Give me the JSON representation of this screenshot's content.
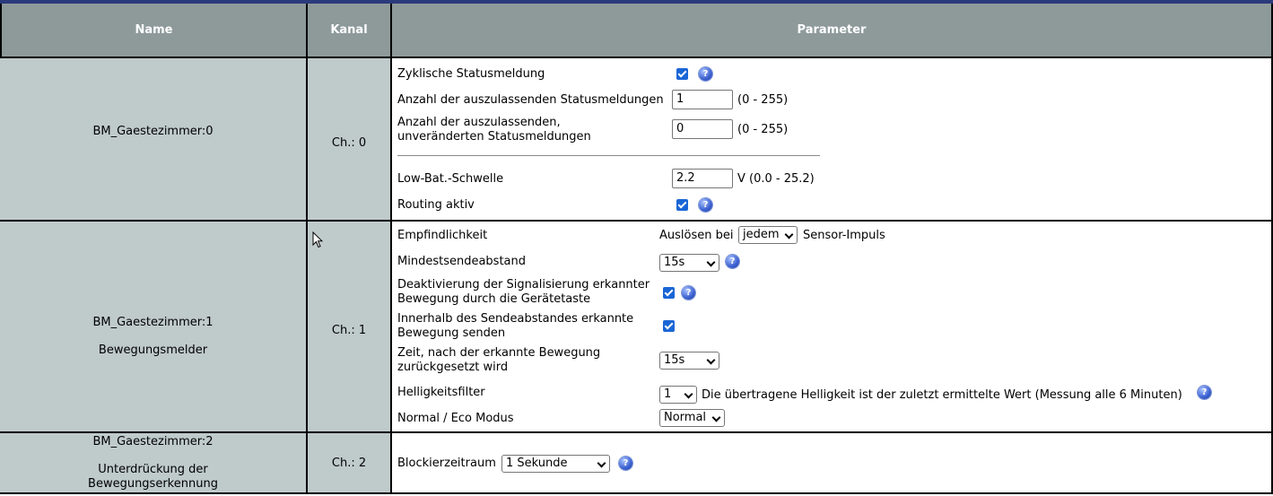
{
  "header": {
    "name": "Name",
    "kanal": "Kanal",
    "parameter": "Parameter"
  },
  "rows": [
    {
      "name": "BM_Gaestezimmer:0",
      "channel": "Ch.: 0",
      "params": {
        "cyclic_status_label": "Zyklische Statusmeldung",
        "cyclic_status_checked": true,
        "skip_status_label": "Anzahl der auszulassenden Statusmeldungen",
        "skip_status_value": "1",
        "skip_status_range": "(0 - 255)",
        "skip_unchanged_label": "Anzahl der auszulassenden, unveränderten Statusmeldungen",
        "skip_unchanged_value": "0",
        "skip_unchanged_range": "(0 - 255)",
        "lowbat_label": "Low-Bat.-Schwelle",
        "lowbat_value": "2.2",
        "lowbat_unit_range": "V (0.0 - 25.2)",
        "routing_label": "Routing aktiv",
        "routing_checked": true
      }
    },
    {
      "name": "BM_Gaestezimmer:1",
      "subname": "Bewegungsmelder",
      "channel": "Ch.: 1",
      "params": {
        "sensitivity_label": "Empfindlichkeit",
        "sensitivity_prefix": "Auslösen bei",
        "sensitivity_value": "jedem",
        "sensitivity_suffix": "Sensor-Impuls",
        "min_interval_label": "Mindestsendeabstand",
        "min_interval_value": "15s",
        "deactivate_signal_label": "Deaktivierung der Signalisierung erkannter Bewegung durch die Gerätetaste",
        "deactivate_signal_checked": true,
        "send_within_label": "Innerhalb des Sendeabstandes erkannte Bewegung senden",
        "send_within_checked": true,
        "reset_time_label": "Zeit, nach der erkannte Bewegung zurückgesetzt wird",
        "reset_time_value": "15s",
        "brightness_label": "Helligkeitsfilter",
        "brightness_value": "1",
        "brightness_note": "Die übertragene Helligkeit ist der zuletzt ermittelte Wert (Messung alle 6 Minuten)",
        "mode_label": "Normal / Eco Modus",
        "mode_value": "Normal"
      }
    },
    {
      "name": "BM_Gaestezimmer:2",
      "subname": "Unterdrückung der Bewegungserkennung",
      "channel": "Ch.: 2",
      "params": {
        "block_label": "Blockierzeitraum",
        "block_value": "1 Sekunde"
      }
    }
  ],
  "icons": {
    "help": "help-icon",
    "cursor": "mouse-cursor-icon"
  },
  "colors": {
    "header_bg": "#8e9a9a",
    "name_bg": "#bfcacb",
    "checkbox": "#1a66d6",
    "topbar": "#2b3a7a"
  }
}
